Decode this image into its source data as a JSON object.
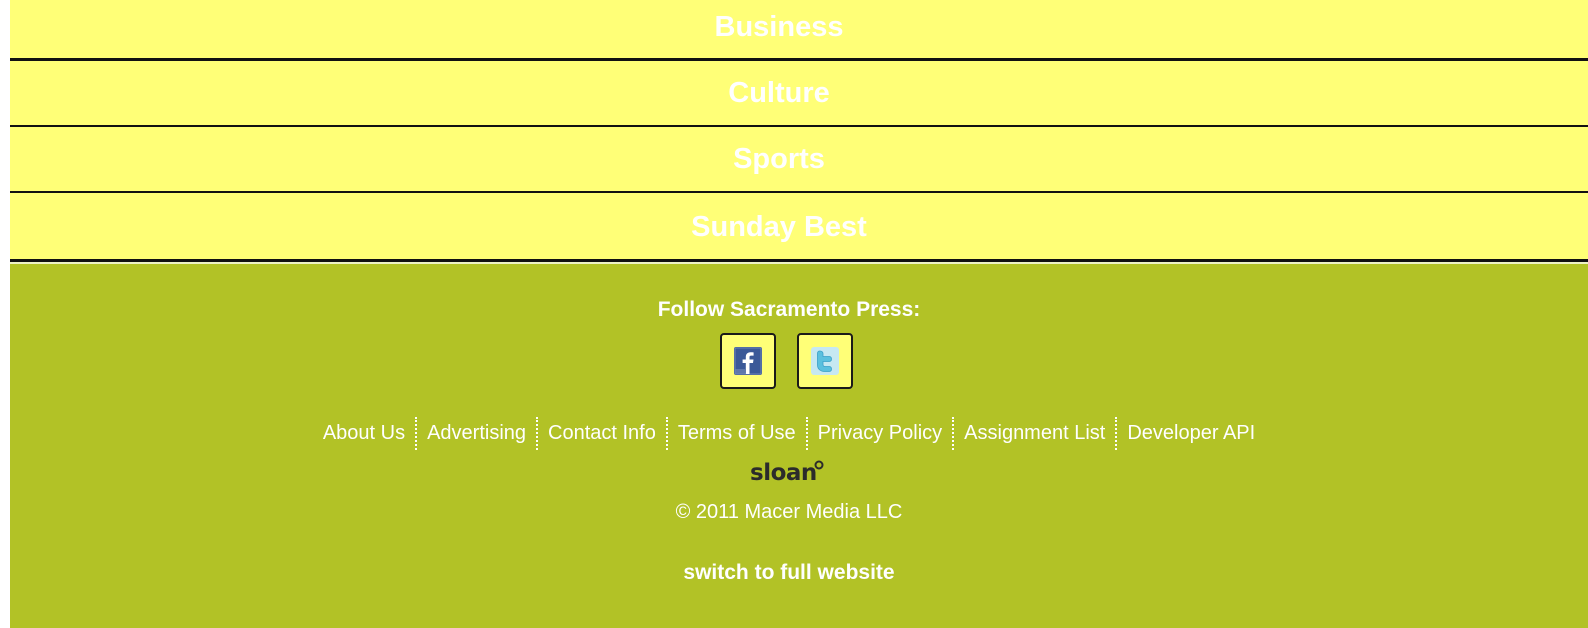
{
  "nav": {
    "items": [
      {
        "label": "Business"
      },
      {
        "label": "Culture"
      },
      {
        "label": "Sports"
      },
      {
        "label": "Sunday Best"
      }
    ]
  },
  "footer": {
    "follow_title": "Follow Sacramento Press:",
    "social": [
      {
        "name": "facebook",
        "icon": "facebook-icon"
      },
      {
        "name": "twitter",
        "icon": "twitter-icon"
      }
    ],
    "links": [
      {
        "label": "About Us"
      },
      {
        "label": "Advertising"
      },
      {
        "label": "Contact Info"
      },
      {
        "label": "Terms of Use"
      },
      {
        "label": "Privacy Policy"
      },
      {
        "label": "Assignment List"
      },
      {
        "label": "Developer API"
      }
    ],
    "logo_text": "sloan",
    "copyright": "© 2011 Macer Media LLC",
    "switch_label": "switch to full website"
  },
  "colors": {
    "nav_background": "#ffff77",
    "footer_background": "#b2c226",
    "text": "#ffffff",
    "separator": "#111111"
  }
}
